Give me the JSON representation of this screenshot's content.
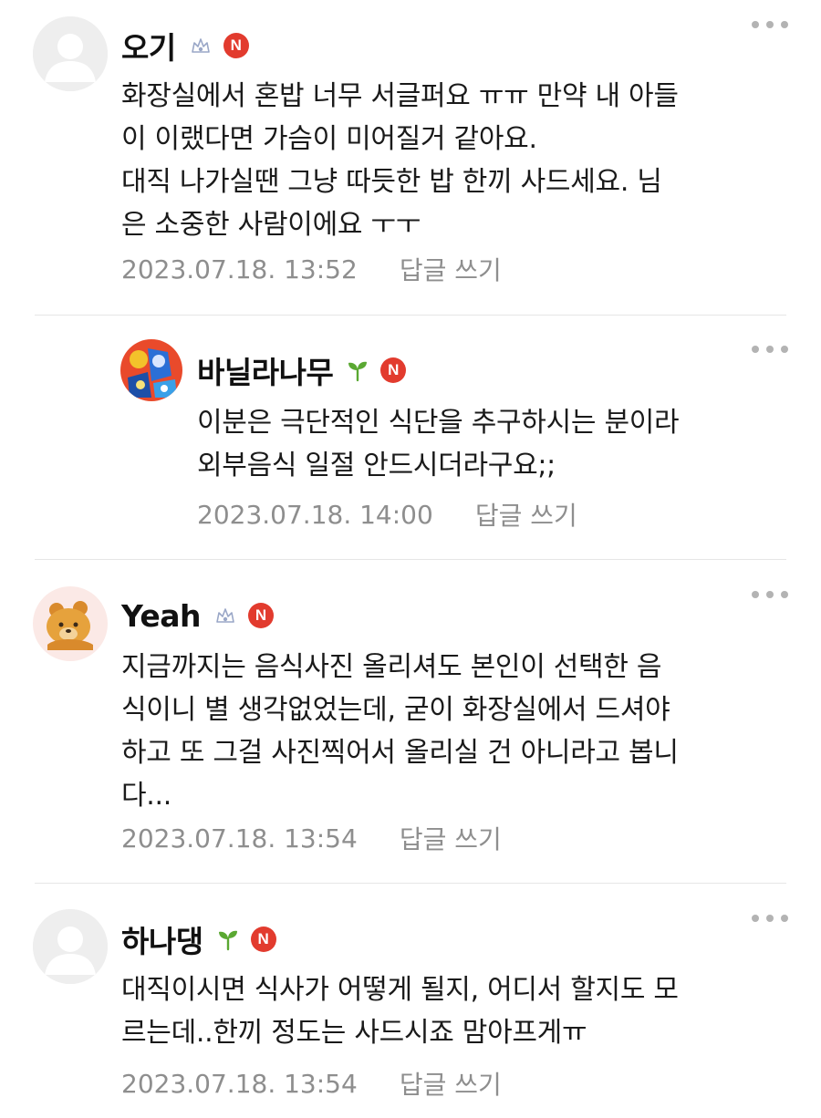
{
  "comments": [
    {
      "author": "오기",
      "badge": "crown-grade-icon",
      "new_badge": "N",
      "text": "화장실에서 혼밥 너무 서글퍼요 ㅠㅠ 만약 내 아들\n이 이랬다면 가슴이 미어질거 같아요.\n대직 나가실땐 그냥 따듯한 밥 한끼 사드세요. 님\n은 소중한 사람이에요 ㅜㅜ",
      "timestamp": "2023.07.18. 13:52",
      "reply_label": "답글 쓰기"
    },
    {
      "author": "바닐라나무",
      "badge": "sprout-grade-icon",
      "new_badge": "N",
      "text": "이분은 극단적인 식단을 추구하시는 분이라\n외부음식 일절 안드시더라구요;;",
      "timestamp": "2023.07.18. 14:00",
      "reply_label": "답글 쓰기"
    },
    {
      "author": "Yeah",
      "badge": "crown-grade-icon",
      "new_badge": "N",
      "text": "지금까지는 음식사진 올리셔도 본인이 선택한 음\n식이니 별 생각없었는데, 굳이 화장실에서 드셔야\n하고 또 그걸 사진찍어서 올리실 건 아니라고 봅니\n다...",
      "timestamp": "2023.07.18. 13:54",
      "reply_label": "답글 쓰기"
    },
    {
      "author": "하나댕",
      "badge": "sprout-grade-icon",
      "new_badge": "N",
      "text": "대직이시면 식사가 어떻게 될지, 어디서 할지도 모\n르는데..한끼 정도는 사드시죠 맘아프게ㅠ",
      "timestamp": "2023.07.18. 13:54",
      "reply_label": "답글 쓰기"
    }
  ],
  "colors": {
    "new_badge": "#e23b2e",
    "meta_text": "#8e8e8e",
    "sprout": "#5aa832",
    "crown": "#9aa7c7"
  }
}
